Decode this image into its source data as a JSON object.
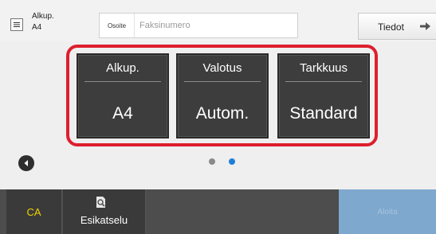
{
  "header": {
    "original_label": "Alkup.",
    "original_value": "A4",
    "address_label": "Osoite",
    "address_placeholder": "Faksinumero",
    "info_button": "Tiedot"
  },
  "settings": [
    {
      "label": "Alkup.",
      "value": "A4"
    },
    {
      "label": "Valotus",
      "value": "Autom."
    },
    {
      "label": "Tarkkuus",
      "value": "Standard"
    }
  ],
  "pager": {
    "pages": 2,
    "current": 2
  },
  "footer": {
    "ca_label": "CA",
    "preview_label": "Esikatselu",
    "start_label": "Aloita"
  },
  "colors": {
    "highlight": "#dd1f2d",
    "tile": "#3d3d3d",
    "active_dot": "#1e7fd8",
    "ca_text": "#f0d400",
    "start_bg": "#7fa8cf"
  }
}
